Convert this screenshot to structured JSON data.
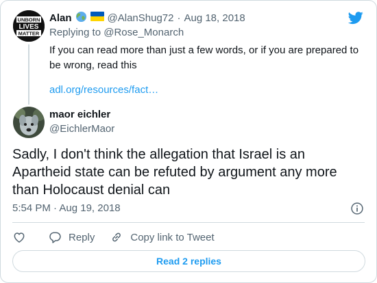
{
  "parent_tweet": {
    "author_name": "Alan",
    "handle": "@AlanShug72",
    "date": "Aug 18, 2018",
    "avatar_text": [
      "UNBORN",
      "LIVES",
      "MATTER"
    ],
    "replying_to_label": "Replying to",
    "replying_to_handle": "@Rose_Monarch",
    "text": "If you can read more than just a few words, or if you are prepared to be wrong, read this",
    "link": "adl.org/resources/fact…"
  },
  "tweet": {
    "author_name": "maor eichler",
    "handle": "@EichlerMaor",
    "text": "Sadly, I don't think the allegation that Israel is an Apartheid state can be refuted by argument any more than Holocaust denial can",
    "time": "5:54 PM",
    "date": "Aug 19, 2018"
  },
  "actions": {
    "reply_label": "Reply",
    "copy_link_label": "Copy link to Tweet"
  },
  "read_replies_label": "Read 2 replies",
  "colors": {
    "accent": "#1d9bf0",
    "secondary_text": "#536471",
    "border": "#cfd9de"
  }
}
